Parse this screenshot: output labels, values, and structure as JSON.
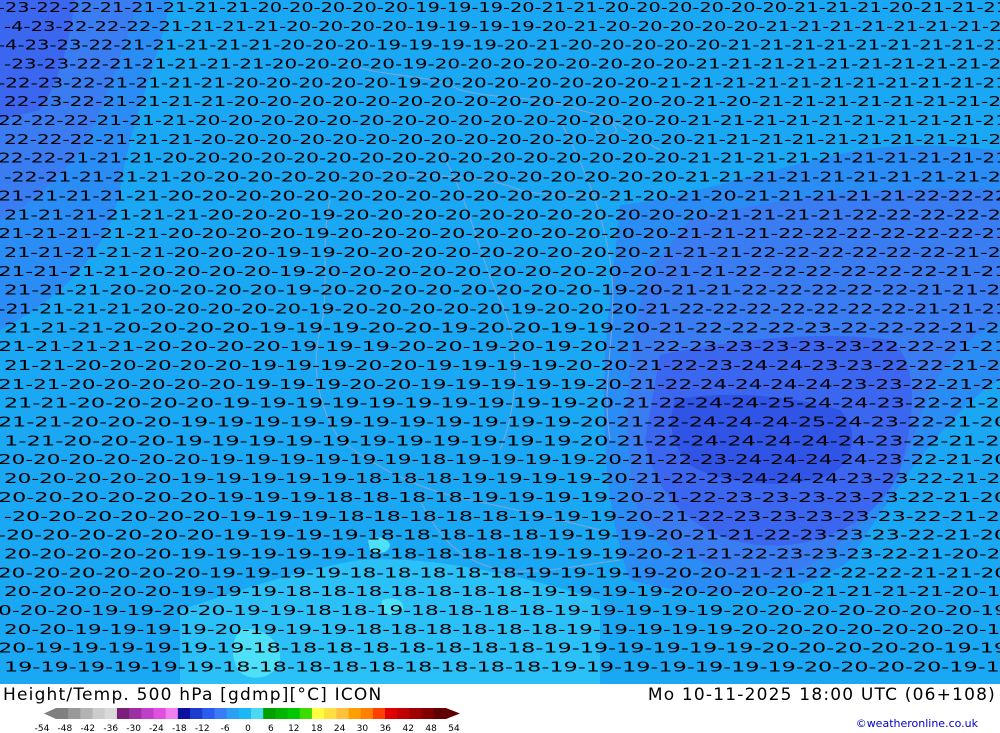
{
  "map": {
    "colors": {
      "ocean_bg": "#1aa8f5",
      "band_21": "#2a8cf5",
      "band_22": "#3a7cf2",
      "band_23": "#3b66f0",
      "band_24": "#2f54e6",
      "band_18": "#2bc0f8",
      "band_17": "#4ee0f8",
      "borders": "#7ea7d8"
    },
    "label_rows": [
      "-23 22 22 21 21 21 21 21 20 20 20 20 20 19 19 19 20 21 21 20 20 20 20 20 20 21 21 21 20 21 21 21",
      "-4 23 22 22 22 21 21 21 21 20 20 20 20 19 19 19 19 20 21 20 20 20 20 20 21 21 21 21 21 21 21 21",
      "-4 23 23 22 21 21 21 21 21 20 20 20 19 19 19 19 20 21 20 20 20 20 20 21 21 21 21 21 21 21 21 21",
      "-23 23 22 21 21 21 21 21 20 20 20 20 19 20 20 20 20 20 20 20 20 21 21 21 21 21 21 21 21 21 21",
      "-22 23 22 21 21 21 21 20 20 20 20 20 19 20 20 20 20 20 20 20 21 21 21 21 21 21 21 21 21 21 21",
      "22 23 22 21 21 21 21 20 20 20 20 20 20 20 20 20 20 20 20 20 20 21 20 21 21 21 21 21 21 21 21",
      "22 22 22 21 21 21 20 20 20 20 20 20 20 20 20 20 20 20 20 20 20 21 21 21 21 21 21 21 21 21 21",
      "22 22 22 21 21 21 20 20 20 20 20 20 20 20 20 20 20 20 20 20 20 21 21 21 21 21 21 21 21 21 21",
      "22 22 21 21 21 20 20 20 20 20 20 20 20 20 20 20 20 20 20 20 20 21 21 21 21 21 21 21 21 21 21",
      "-22 21 21 21 21 20 20 20 20 20 20 20 20 20 20 20 20 20 20 20 21 21 21 21 21 21 21 21 21 22",
      "21 21 21 21 21 20 20 20 20 20 20 20 20 20 20 20 20 20 21 20 21 20 21 21 21 21 21 22 22 22",
      "21 21 21 21 21 21 20 20 20 19 20 20 20 20 20 20 20 20 20 20 20 21 21 21 21 22 22 22 22 21",
      "21 21 21 21 21 20 20 20 20 19 20 20 20 20 20 20 20 20 20 20 21 21 21 22 22 22 22 22 22 21",
      "21 21 21 21 21 20 20 20 19 19 20 20 20 20 20 20 20 20 20 21 21 21 22 22 22 22 22 22 21 21",
      "21 21 21 21 20 20 20 20 19 20 20 20 20 20 20 20 20 20 20 21 21 22 22 22 22 22 22 21 21",
      "21 21 21 20 20 20 20 20 19 20 20 20 20 20 20 20 20 19 20 21 21 22 22 22 22 22 21 21 21",
      "-21 21 21 21 20 20 20 20 20 19 20 20 20 20 20 19 20 20 20 21 22 22 22 22 22 22 22 21 21 21",
      "21 21 21 20 20 20 20 19 19 19 20 20 19 20 20 19 19 20 21 22 22 22 23 22 22 22 21 21",
      "21 21 21 21 20 20 20 20 19 19 19 20 20 19 20 19 20 21 22 23 23 23 23 23 22 22 21 21",
      "21 21 20 20 20 20 20 19 19 19 20 20 19 19 19 19 20 20 21 22 23 24 24 23 23 22 22 21 21",
      "21 21 20 20 20 20 20 19 19 19 20 20 19 19 19 19 19 20 21 22 24 24 24 24 23 23 22 21 21",
      "21 21 20 20 20 20 19 19 19 19 19 19 19 19 19 19 20 21 22 24 24 25 24 24 23 22 21 21",
      "21 21 20 20 20 19 19 19 19 19 19 19 19 19 19 19 20 21 22 24 24 24 25 24 23 22 21 20",
      "1 21 20 20 20 19 19 19 19 19 19 19 19 19 19 19 20 21 22 24 24 24 24 24 23 22 21 20",
      "20 20 20 20 20 20 19 19 19 19 19 19 18 19 19 19 19 20 21 22 23 24 24 24 24 23 22 21 20",
      "20 20 20 20 20 19 19 19 19 19 18 18 18 19 19 19 19 20 21 22 23 24 24 24 23 23 22 21 20",
      "20 20 20 20 20 20 19 19 19 18 18 18 18 19 19 19 19 20 21 22 23 23 23 23 23 22 21 20",
      "-20 20 20 20 20 20 19 19 19 18 18 18 18 18 19 19 19 20 21 22 23 23 23 23 23 22 21 20",
      "-20 20 20 20 20 20 19 19 19 19 18 18 18 18 18 19 19 19 20 21 21 22 23 23 23 22 21 20",
      "20 20 20 20 20 19 19 19 19 19 18 18 18 18 18 19 19 19 20 21 21 22 23 23 23 22 21 20 20",
      "20 20 20 20 20 20 19 19 19 19 18 18 18 18 18 19 19 19 19 20 20 21 21 22 22 22 21 21 20",
      "20 20 20 20 20 19 19 19 18 18 18 18 18 18 18 19 19 19 19 20 20 20 20 21 21 21 21 20 19",
      "0 20 20 19 19 20 20 19 19 18 18 19 18 18 18 18 19 19 19 19 19 20 20 20 20 20 20 20 19",
      "20 20 19 19 19 19 20 19 19 19 18 18 18 18 18 18 19 19 19 19 19 20 20 20 20 20 20 20 19",
      "20 19 19 19 19 19 19 18 18 18 18 18 18 18 18 19 19 19 19 19 19 20 20 20 20 20 19 19",
      "19 19 19 19 19 19 18 18 18 18 18 18 18 18 18 19 19 19 19 19 19 19 20 20 20 20 19 19"
    ]
  },
  "footer": {
    "product_title": "Height/Temp. 500 hPa [gdmp][°C] ICON",
    "valid_time": "Mo 10-11-2025 18:00 UTC (06+108)",
    "credit": "©weatheronline.co.uk",
    "legend": {
      "ticks": [
        "-54",
        "-48",
        "-42",
        "-36",
        "-30",
        "-24",
        "-18",
        "-12",
        "-6",
        "0",
        "6",
        "12",
        "18",
        "24",
        "30",
        "36",
        "42",
        "48",
        "54"
      ],
      "colors": [
        "#7f7f7f",
        "#999999",
        "#b3b3b3",
        "#cccccc",
        "#d9d9d9",
        "#7a1f7a",
        "#9b2fa3",
        "#c03fc8",
        "#e04fe0",
        "#f07ff0",
        "#1010a0",
        "#1c3ccc",
        "#2a5cf0",
        "#3a7cf5",
        "#2aa0f5",
        "#1ab8f5",
        "#4ad8f5",
        "#00a000",
        "#00b400",
        "#00c800",
        "#3cdc00",
        "#ffff40",
        "#ffe040",
        "#ffc040",
        "#ffa000",
        "#ff8000",
        "#ff4000",
        "#e00000",
        "#c00000",
        "#a00000",
        "#800000",
        "#600000"
      ]
    }
  }
}
